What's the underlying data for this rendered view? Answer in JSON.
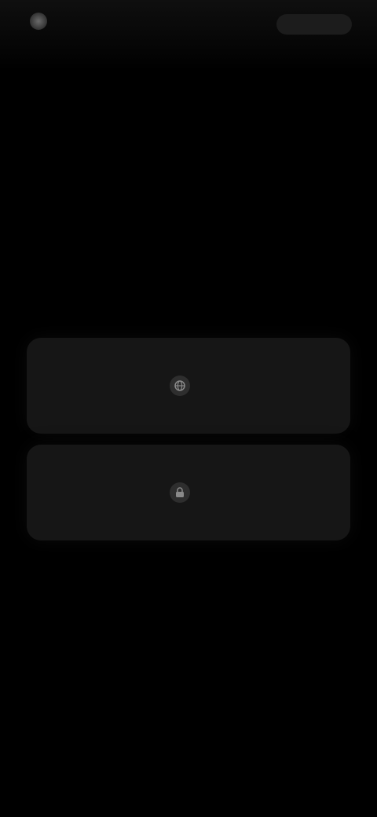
{
  "header": {
    "logo_icon": "globe-icon",
    "logo_text": "",
    "action_label": ""
  },
  "page": {
    "title": ""
  },
  "options": [
    {
      "icon": "globe-icon",
      "label": ""
    },
    {
      "icon": "lock-icon",
      "label": ""
    }
  ],
  "colors": {
    "background": "#000000",
    "card": "#161616",
    "brand": "#5a1212"
  }
}
